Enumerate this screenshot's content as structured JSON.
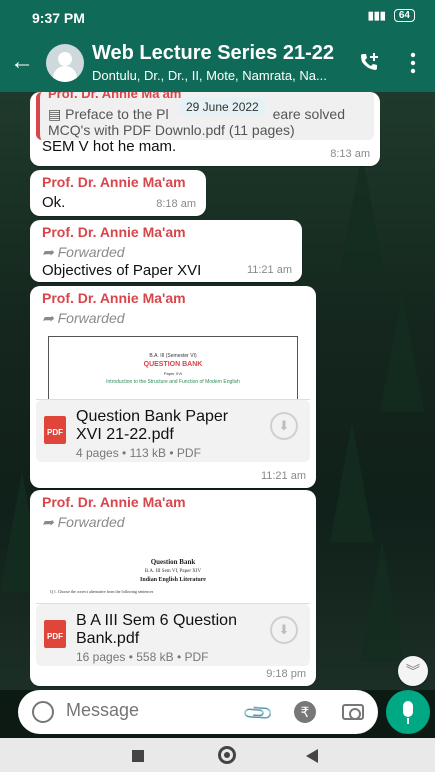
{
  "status": {
    "time": "9:37 PM",
    "battery": "64"
  },
  "header": {
    "title": "Web Lecture Series 21-22",
    "subtitle": "Dontulu, Dr., Dr., II, Mote, Namrata, Na..."
  },
  "date_chip": "29 June 2022",
  "messages": [
    {
      "quote_sender": "Prof. Dr. Annie Ma'am",
      "quote_line1": "▤ Preface to the Pl",
      "quote_line1b": "eare solved",
      "quote_line2": "MCQ's with PDF Downlo.pdf (11 pages)",
      "text": "SEM V hot he mam.",
      "time": "8:13 am"
    },
    {
      "sender": "Prof. Dr. Annie Ma'am",
      "text": "Ok.",
      "time": "8:18 am"
    },
    {
      "sender": "Prof. Dr. Annie Ma'am",
      "forwarded": "Forwarded",
      "text": "Objectives of Paper XVI",
      "time": "11:21 am"
    },
    {
      "sender": "Prof. Dr. Annie Ma'am",
      "forwarded": "Forwarded",
      "doc_name": "Question Bank Paper XVI 21-22.pdf",
      "doc_meta": "4 pages • 113 kB • PDF",
      "thumb_line1": "B.A. III (Semester VI)",
      "thumb_line2": "QUESTION BANK",
      "thumb_line3": "Paper XVI",
      "thumb_line4": "Introduction to the Structure and Function of Modern English",
      "time": "11:21 am"
    },
    {
      "sender": "Prof. Dr. Annie Ma'am",
      "forwarded": "Forwarded",
      "doc_name": "B A III Sem 6 Question Bank.pdf",
      "doc_meta": "16 pages • 558 kB • PDF",
      "thumb_line1": "Question Bank",
      "thumb_line2": "B.A. III Sem VI, Paper XIV",
      "thumb_line3": "Indian English Literature",
      "thumb_line4": "Q 1. Choose the correct alternative from the following sentences",
      "time": "9:18 pm"
    }
  ],
  "input": {
    "placeholder": "Message"
  },
  "icons": {
    "pdf": "PDF"
  },
  "colors": {
    "brand": "#0f6b57",
    "accent": "#00a884",
    "sender": "#d8454a"
  }
}
